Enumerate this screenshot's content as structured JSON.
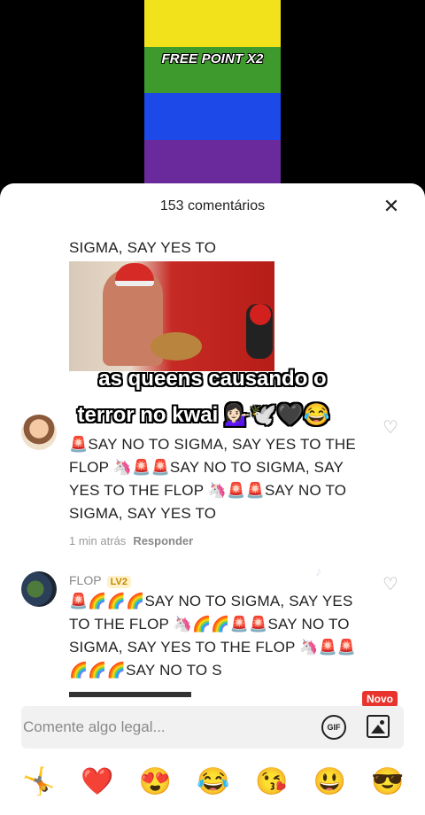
{
  "video": {
    "overlay_text": "FREE POINT X2",
    "flag_colors": [
      "#f2e21c",
      "#3f9a2e",
      "#1d49e8",
      "#6b2a9c"
    ]
  },
  "sheet": {
    "title": "153 comentários",
    "close_icon": "close-icon"
  },
  "comments": [
    {
      "text_first_line": "SIGMA, SAY YES TO"
    },
    {
      "body": "🚨SAY NO TO SIGMA, SAY YES TO THE FLOP 🦄🚨🚨SAY NO TO SIGMA, SAY YES TO THE FLOP 🦄🚨🚨SAY NO TO SIGMA, SAY YES TO",
      "time": "1 min atrás",
      "reply_label": "Responder"
    },
    {
      "username": "FLOP",
      "level": "LV2",
      "body": "🚨🌈🌈🌈SAY NO TO SIGMA, SAY YES TO THE FLOP 🦄🌈🌈🚨🚨SAY NO TO SIGMA, SAY YES TO THE FLOP 🦄🚨🚨 🌈🌈🌈SAY NO TO S"
    }
  ],
  "captions": {
    "line1": "as queens causando o",
    "line2": "terror no kwai 💁🏻‍♀️🕊️🖤😂"
  },
  "input": {
    "placeholder": "Comente algo legal...",
    "new_badge": "Novo",
    "gif_label": "GIF"
  },
  "emojis": [
    "🤸",
    "❤️",
    "😍",
    "😂",
    "😘",
    "😃",
    "😎"
  ]
}
